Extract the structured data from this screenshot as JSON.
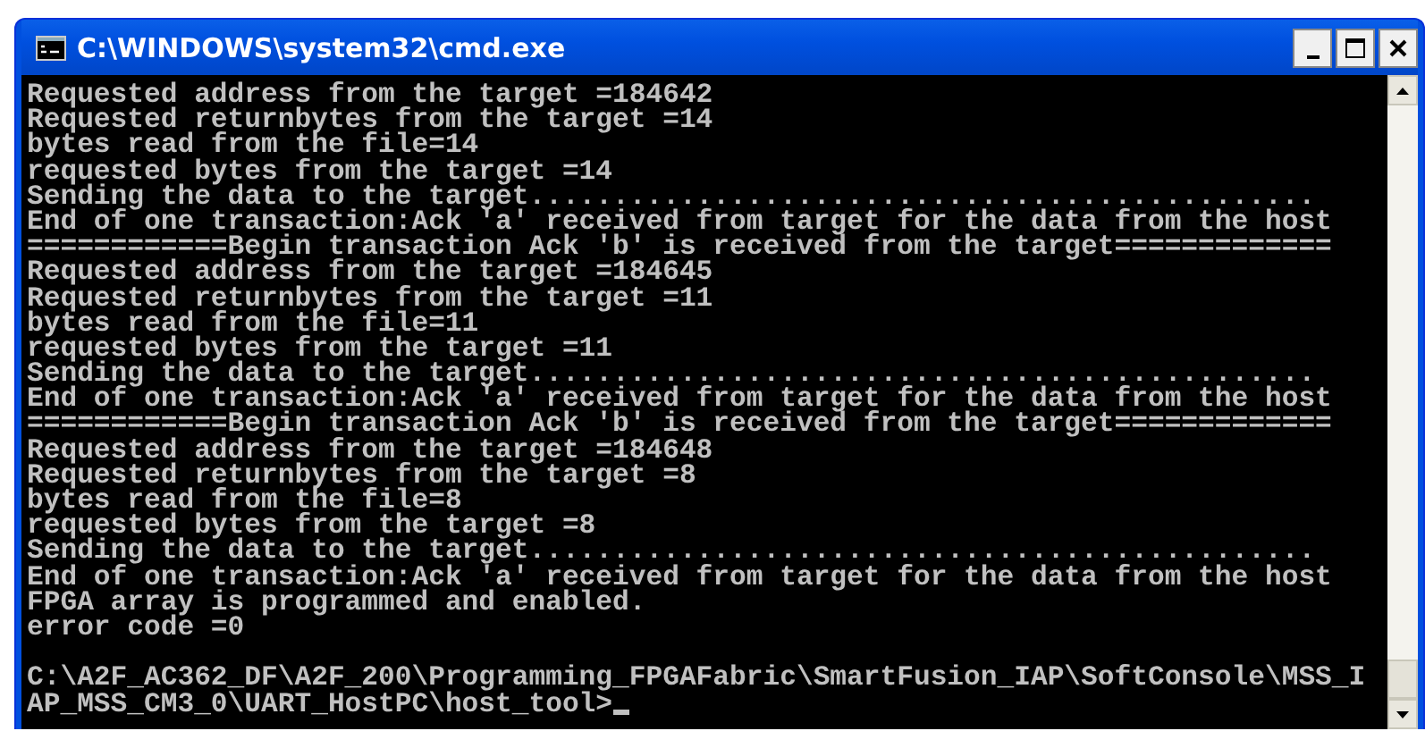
{
  "window": {
    "title": "C:\\WINDOWS\\system32\\cmd.exe"
  },
  "console": {
    "cursor": true,
    "lines": [
      {
        "kind": "text",
        "text": "Requested address from the target =184642"
      },
      {
        "kind": "text",
        "text": "Requested returnbytes from the target =14"
      },
      {
        "kind": "text",
        "text": "bytes read from the file=14"
      },
      {
        "kind": "text",
        "text": "requested bytes from the target =14"
      },
      {
        "kind": "text",
        "text": "Sending the data to the target..............................................."
      },
      {
        "kind": "text",
        "text": "End of one transaction:Ack 'a' received from target for the data from the host"
      },
      {
        "kind": "text",
        "text": "============Begin transaction Ack 'b' is received from the target============="
      },
      {
        "kind": "text",
        "text": "Requested address from the target =184645"
      },
      {
        "kind": "text",
        "text": "Requested returnbytes from the target =11"
      },
      {
        "kind": "text",
        "text": "bytes read from the file=11"
      },
      {
        "kind": "text",
        "text": "requested bytes from the target =11"
      },
      {
        "kind": "text",
        "text": "Sending the data to the target..............................................."
      },
      {
        "kind": "text",
        "text": "End of one transaction:Ack 'a' received from target for the data from the host"
      },
      {
        "kind": "text",
        "text": "============Begin transaction Ack 'b' is received from the target============="
      },
      {
        "kind": "text",
        "text": "Requested address from the target =184648"
      },
      {
        "kind": "text",
        "text": "Requested returnbytes from the target =8"
      },
      {
        "kind": "text",
        "text": "bytes read from the file=8"
      },
      {
        "kind": "text",
        "text": "requested bytes from the target =8"
      },
      {
        "kind": "text",
        "text": "Sending the data to the target..............................................."
      },
      {
        "kind": "text",
        "text": "End of one transaction:Ack 'a' received from target for the data from the host"
      },
      {
        "kind": "text",
        "text": "FPGA array is programmed and enabled."
      },
      {
        "kind": "text",
        "text": "error code =0"
      },
      {
        "kind": "blank"
      },
      {
        "kind": "text",
        "text": "C:\\A2F_AC362_DF\\A2F_200\\Programming_FPGAFabric\\SmartFusion_IAP\\SoftConsole\\MSS_I"
      },
      {
        "kind": "text",
        "text": "AP_MSS_CM3_0\\UART_HostPC\\host_tool>"
      }
    ]
  }
}
